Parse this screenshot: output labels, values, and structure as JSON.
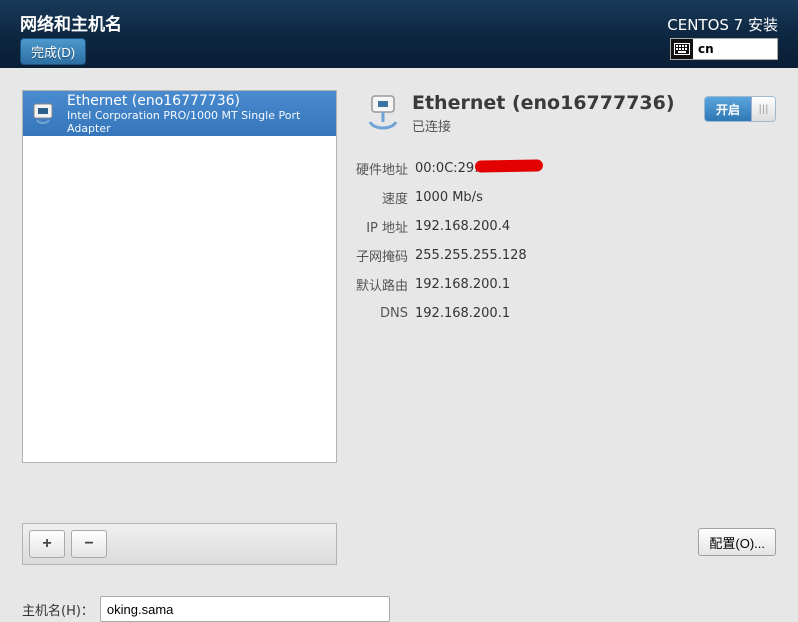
{
  "header": {
    "title": "网络和主机名",
    "done_label": "完成(D)",
    "installer_title": "CENTOS 7 安装",
    "input_method": "cn"
  },
  "network_list": {
    "items": [
      {
        "name": "Ethernet (eno16777736)",
        "subtitle": "Intel Corporation PRO/1000 MT Single Port Adapter"
      }
    ]
  },
  "buttons": {
    "add": "+",
    "remove": "−",
    "configure": "配置(O)..."
  },
  "detail": {
    "title": "Ethernet (eno16777736)",
    "status": "已连接",
    "toggle_on_label": "开启",
    "rows": {
      "hwaddr_label": "硬件地址",
      "hwaddr_value_prefix": "00:0C:29:",
      "speed_label": "速度",
      "speed_value": "1000 Mb/s",
      "ip_label": "IP 地址",
      "ip_value": "192.168.200.4",
      "netmask_label": "子网掩码",
      "netmask_value": "255.255.255.128",
      "gateway_label": "默认路由",
      "gateway_value": "192.168.200.1",
      "dns_label": "DNS",
      "dns_value": "192.168.200.1"
    }
  },
  "hostname": {
    "label": "主机名(H)：",
    "value": "oking.sama"
  }
}
